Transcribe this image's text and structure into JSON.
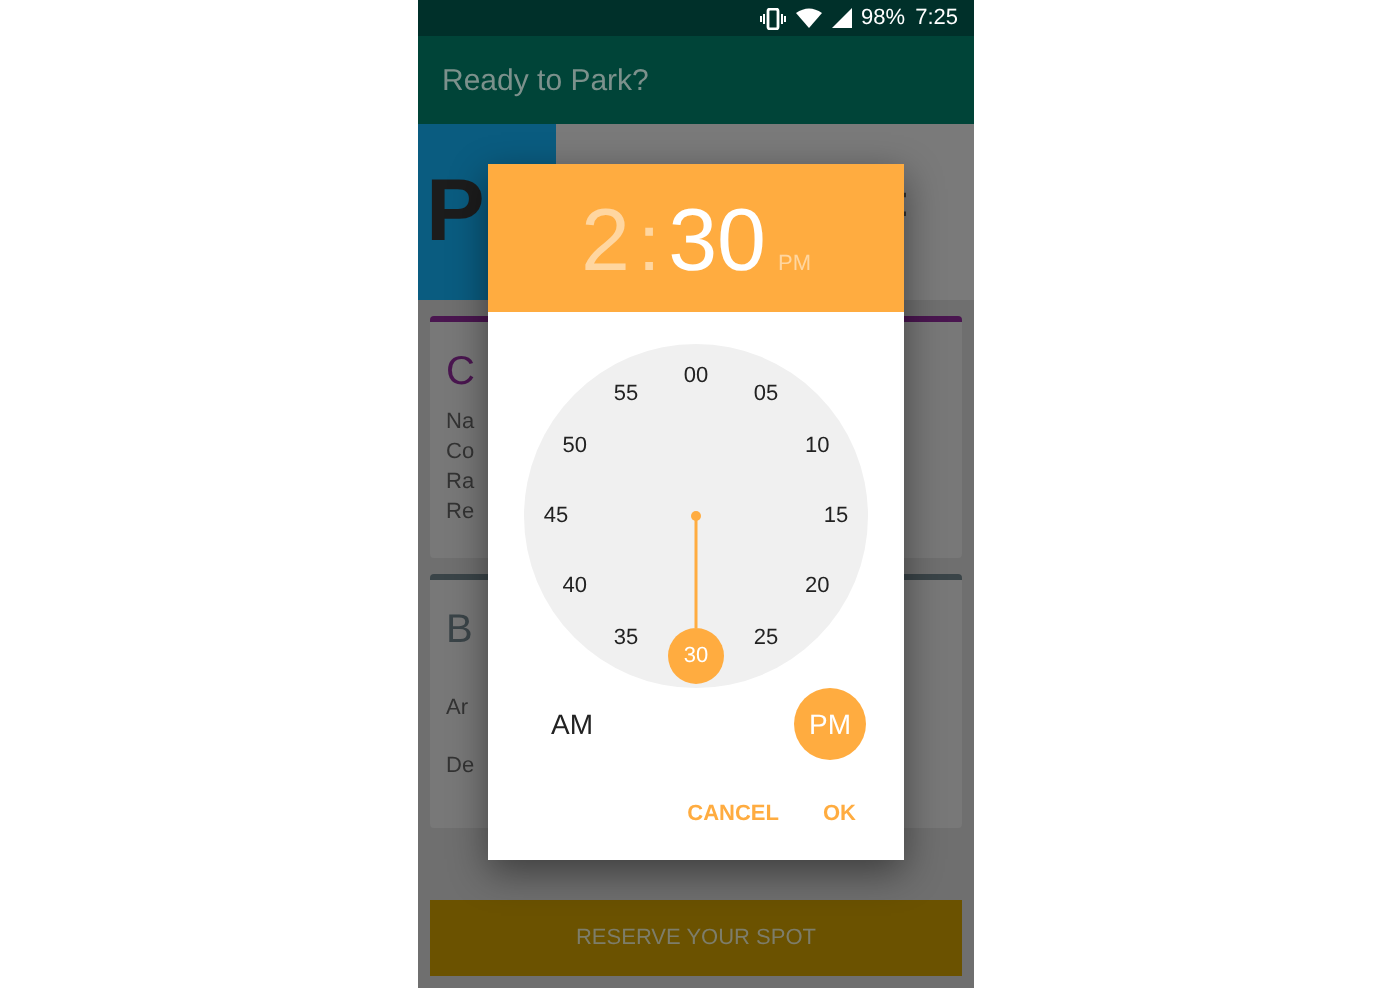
{
  "status_bar": {
    "battery": "98%",
    "time": "7:25"
  },
  "app_bar": {
    "title": "Ready to Park?"
  },
  "background": {
    "logo_letter": "P",
    "header_fragment": ":",
    "cards": [
      {
        "title": "C",
        "lines": [
          "Na",
          "Co",
          "Ra",
          "Re"
        ],
        "kind": "purple"
      },
      {
        "title": "B",
        "lines": [
          "Ar",
          "De"
        ],
        "kind": "slate"
      }
    ],
    "reserve_button": "RESERVE YOUR SPOT"
  },
  "time_picker": {
    "header": [
      {
        "kind": "hour",
        "text": "2",
        "selected": false
      },
      {
        "kind": "separator",
        "text": ":",
        "selected": false
      },
      {
        "kind": "minute",
        "text": "30",
        "selected": true
      },
      {
        "kind": "period",
        "text": "PM",
        "selected": false
      }
    ],
    "minutes": [
      {
        "label": "00",
        "selected": false
      },
      {
        "label": "05",
        "selected": false
      },
      {
        "label": "10",
        "selected": false
      },
      {
        "label": "15",
        "selected": false
      },
      {
        "label": "20",
        "selected": false
      },
      {
        "label": "25",
        "selected": false
      },
      {
        "label": "30",
        "selected": true
      },
      {
        "label": "35",
        "selected": false
      },
      {
        "label": "40",
        "selected": false
      },
      {
        "label": "45",
        "selected": false
      },
      {
        "label": "50",
        "selected": false
      },
      {
        "label": "55",
        "selected": false
      }
    ],
    "periods": [
      {
        "label": "AM",
        "selected": false
      },
      {
        "label": "PM",
        "selected": true
      }
    ],
    "buttons": [
      "CANCEL",
      "OK"
    ]
  }
}
